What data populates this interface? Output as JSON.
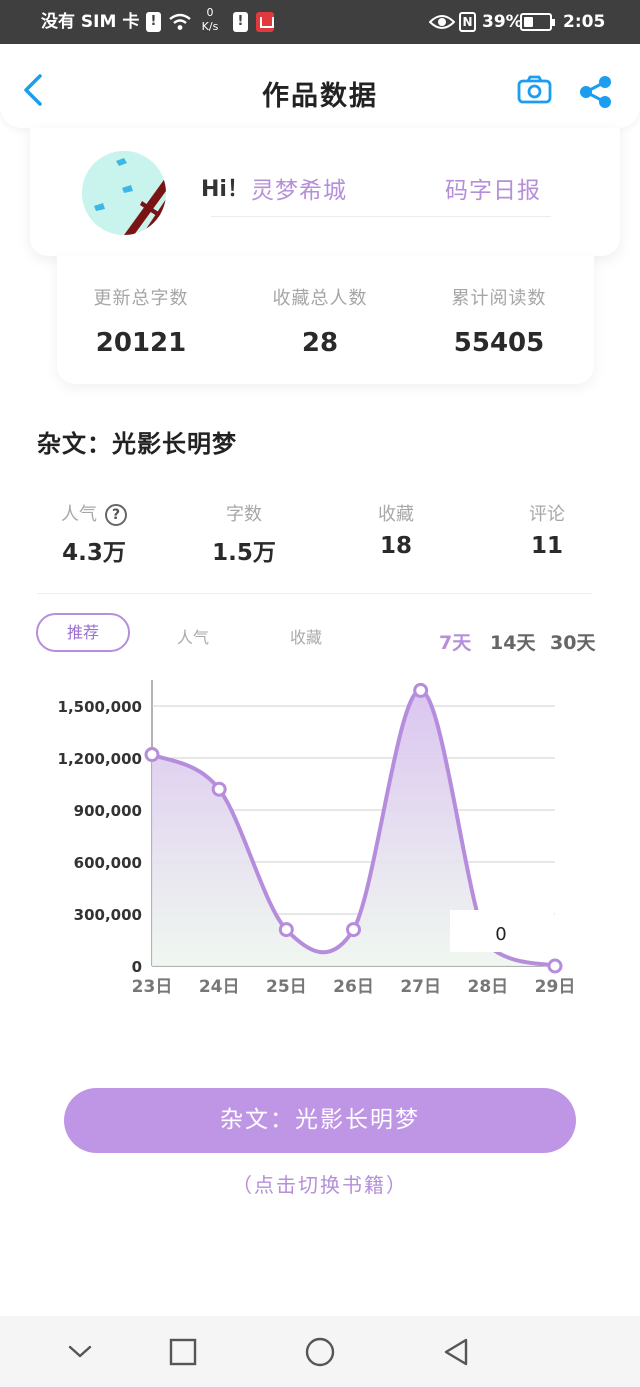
{
  "status_bar": {
    "carrier": "没有 SIM 卡",
    "alert_badge": "!",
    "speed_value": "0",
    "speed_unit": "K/s",
    "battery_alert": "!",
    "nfc": "N",
    "battery_percent": "39%",
    "battery_level": 0.39,
    "time": "2:05"
  },
  "header": {
    "title": "作品数据",
    "back_icon": "chevron-left-icon",
    "camera_icon": "camera-icon",
    "share_icon": "share-icon"
  },
  "user": {
    "greeting": "Hi！",
    "name": "灵梦希城",
    "daily_report": "码字日报"
  },
  "summary": {
    "stats": [
      {
        "label": "更新总字数",
        "value": "20121"
      },
      {
        "label": "收藏总人数",
        "value": "28"
      },
      {
        "label": "累计阅读数",
        "value": "55405"
      }
    ]
  },
  "book": {
    "title": "杂文：光影长明梦",
    "stats": [
      {
        "label": "人气",
        "value": "4.3万",
        "help": "?"
      },
      {
        "label": "字数",
        "value": "1.5万"
      },
      {
        "label": "收藏",
        "value": "18"
      },
      {
        "label": "评论",
        "value": "11"
      }
    ]
  },
  "tabs": {
    "metrics": [
      "推荐",
      "人气",
      "收藏"
    ],
    "active_metric": "推荐",
    "ranges": [
      "7天",
      "14天",
      "30天"
    ],
    "active_range": "7天"
  },
  "chart_data": {
    "type": "area",
    "x": [
      "23日",
      "24日",
      "25日",
      "26日",
      "27日",
      "28日",
      "29日"
    ],
    "series": [
      {
        "values": [
          1220000,
          1020000,
          210000,
          210000,
          1590000,
          null,
          0
        ]
      }
    ],
    "ylim": [
      0,
      1650000
    ],
    "yticks": [
      0,
      300000,
      600000,
      900000,
      1200000,
      1500000
    ],
    "ytick_labels": [
      "0",
      "300,000",
      "600,000",
      "900,000",
      "1,200,000",
      "1,500,000"
    ],
    "grid": true,
    "line_color": "#b68ddc",
    "tooltip": {
      "text": "0"
    }
  },
  "bottom": {
    "switch_button": "杂文：光影长明梦",
    "switch_hint": "（点击切换书籍）"
  },
  "nav": {
    "icons": [
      "chevron-down-icon",
      "recents-square-icon",
      "home-circle-icon",
      "back-triangle-icon"
    ]
  },
  "colors": {
    "accent": "#b58fda",
    "button": "#bf96e6",
    "status_bar": "#3f3f3f",
    "icon_blue": "#1c9ef0"
  }
}
